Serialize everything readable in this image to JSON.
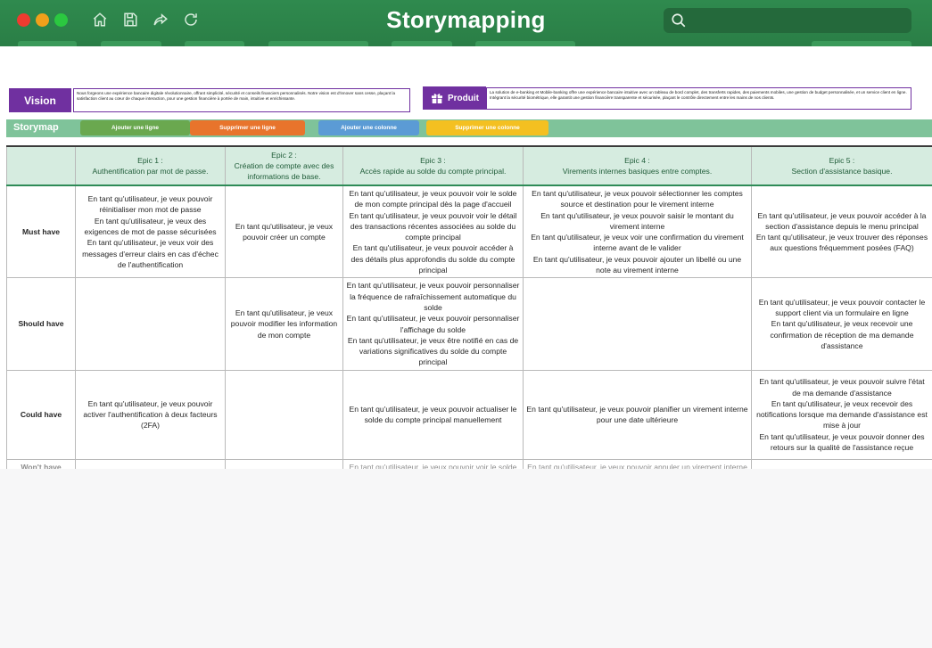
{
  "window": {
    "title": "Storymapping",
    "search_placeholder": ""
  },
  "vision": {
    "label": "Vision",
    "text": "Nous forgeons une expérience bancaire digitale révolutionnaire, offrant simplicité, sécurité et conseils financiers personnalisés. Notre vision est d'innover sans cesse, plaçant la satisfaction client au cœur de chaque interaction, pour une gestion financière à portée de main, intuitive et enrichissante."
  },
  "product": {
    "label": "Produit",
    "text": "La solution de e-banking et Mobile-banking offre une expérience bancaire intuitive avec un tableau de bord complet, des transferts rapides, des paiements mobiles, une gestion de budget personnalisée, et un service client en ligne. Intégrant la sécurité biométrique, elle garantit une gestion financière transparente et sécurisée, plaçant le contrôle directement entre les mains de nos clients."
  },
  "storymap": {
    "label": "Storymap",
    "add_row": "Ajouter une ligne",
    "delete_row": "Supprimer une ligne",
    "add_column": "Ajouter une colonne",
    "delete_column": "Supprimer une colonne"
  },
  "epics": [
    {
      "num": "Epic 1 :",
      "title": "Authentification par mot de passe."
    },
    {
      "num": "Epic 2 :",
      "title": "Création de compte avec des informations de base."
    },
    {
      "num": "Epic 3 :",
      "title": "Accès rapide au solde du compte principal."
    },
    {
      "num": "Epic 4 :",
      "title": "Virements internes basiques entre comptes."
    },
    {
      "num": "Epic 5 :",
      "title": "Section d'assistance basique."
    }
  ],
  "rows": [
    {
      "label": "Must have",
      "cells": [
        "En tant qu'utilisateur, je veux pouvoir réinitialiser mon mot de passe\nEn tant qu'utilisateur, je veux des exigences de mot de passe sécurisées\nEn tant qu'utilisateur, je veux voir des messages d'erreur clairs en cas d'échec de l'authentification",
        "En tant qu'utilisateur, je veux pouvoir créer un compte",
        "En tant qu'utilisateur, je veux pouvoir voir le solde de mon compte principal dès la page d'accueil\nEn tant qu'utilisateur, je veux pouvoir voir le détail des transactions récentes associées au solde du compte principal\nEn tant qu'utilisateur, je veux pouvoir accéder à des détails plus approfondis du solde du compte principal",
        "En tant qu'utilisateur, je veux pouvoir sélectionner les comptes source et destination pour le virement interne\nEn tant qu'utilisateur, je veux pouvoir saisir le montant du virement interne\nEn tant qu'utilisateur, je veux voir une confirmation du virement interne avant de le valider\nEn tant qu'utilisateur, je veux pouvoir ajouter un libellé ou une note au virement interne",
        "En tant qu'utilisateur, je veux pouvoir accéder à la section d'assistance depuis le menu principal\nEn tant qu'utilisateur, je veux trouver des réponses aux questions fréquemment posées (FAQ)"
      ]
    },
    {
      "label": "Should have",
      "cells": [
        "",
        "En tant qu'utilisateur, je veux pouvoir modifier les information de mon compte",
        "En tant qu'utilisateur, je veux pouvoir personnaliser la fréquence de rafraîchissement automatique du solde\nEn tant qu'utilisateur, je veux pouvoir personnaliser l'affichage du solde\nEn tant qu'utilisateur, je veux être notifié en cas de variations significatives du solde du compte principal",
        "",
        "En tant qu'utilisateur, je veux pouvoir contacter le support client via un formulaire en ligne\nEn tant qu'utilisateur, je veux recevoir une confirmation de réception de ma demande d'assistance"
      ]
    },
    {
      "label": "Could have",
      "cells": [
        "En tant qu'utilisateur, je veux pouvoir activer l'authentification à deux facteurs (2FA)",
        "",
        "En tant qu'utilisateur, je veux pouvoir actualiser le solde du compte principal manuellement",
        "En tant qu'utilisateur, je veux pouvoir planifier un virement interne pour une date ultérieure",
        "En tant qu'utilisateur, je veux pouvoir suivre l'état de ma demande d'assistance\nEn tant qu'utilisateur, je veux recevoir des notifications lorsque ma demande d'assistance est mise à jour\nEn tant qu'utilisateur, je veux pouvoir donner des retours sur la qualité de l'assistance reçue"
      ]
    },
    {
      "label": "Won't have",
      "cells": [
        "",
        "",
        "En tant qu'utilisateur, je veux pouvoir voir le solde en différentes devises, le cas échéant",
        "En tant qu'utilisateur, je veux pouvoir annuler un virement interne avant son exécution",
        ""
      ]
    }
  ],
  "colors": {
    "titlebar": "#2f8a4e",
    "purple": "#7030a0",
    "must": "#e8161f",
    "should": "#ef7d1f",
    "could": "#92c26a",
    "wont": "#9a9a9a"
  }
}
